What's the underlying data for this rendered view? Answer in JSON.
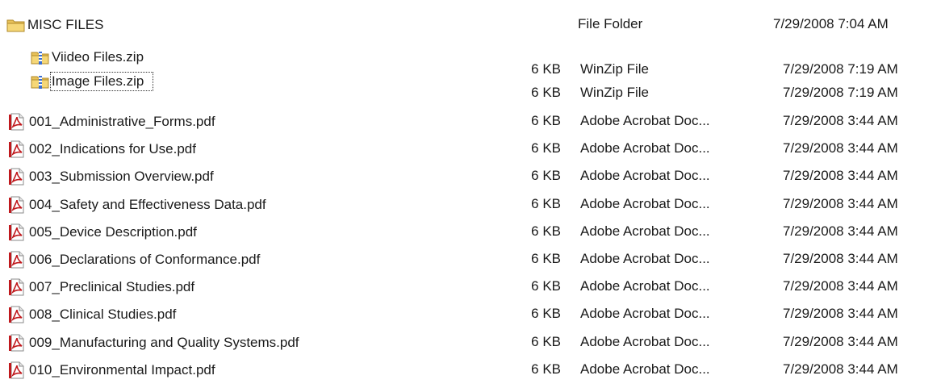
{
  "folder": {
    "name": "MISC FILES",
    "type": "File Folder",
    "modified": "7/29/2008 7:04 AM",
    "icon": "folder-icon"
  },
  "zip_files": [
    {
      "name": "Viideo Files.zip",
      "size": "6 KB",
      "type": "WinZip File",
      "modified": "7/29/2008 7:19 AM",
      "icon": "zip-folder-icon"
    },
    {
      "name": "Image Files.zip",
      "size": "6 KB",
      "type": "WinZip File",
      "modified": "7/29/2008 7:19 AM",
      "icon": "zip-folder-icon"
    }
  ],
  "pdf_files": [
    {
      "name": "001_Administrative_Forms.pdf",
      "size": "6 KB",
      "type": "Adobe Acrobat Doc...",
      "modified": "7/29/2008 3:44 AM",
      "icon": "pdf-icon"
    },
    {
      "name": "002_Indications for Use.pdf",
      "size": "6 KB",
      "type": "Adobe Acrobat Doc...",
      "modified": "7/29/2008 3:44 AM",
      "icon": "pdf-icon"
    },
    {
      "name": "003_Submission Overview.pdf",
      "size": "6 KB",
      "type": "Adobe Acrobat Doc...",
      "modified": "7/29/2008 3:44 AM",
      "icon": "pdf-icon"
    },
    {
      "name": "004_Safety and Effectiveness Data.pdf",
      "size": "6 KB",
      "type": "Adobe Acrobat Doc...",
      "modified": "7/29/2008 3:44 AM",
      "icon": "pdf-icon"
    },
    {
      "name": "005_Device Description.pdf",
      "size": "6 KB",
      "type": "Adobe Acrobat Doc...",
      "modified": "7/29/2008 3:44 AM",
      "icon": "pdf-icon"
    },
    {
      "name": "006_Declarations of Conformance.pdf",
      "size": "6 KB",
      "type": "Adobe Acrobat Doc...",
      "modified": "7/29/2008 3:44 AM",
      "icon": "pdf-icon"
    },
    {
      "name": "007_Preclinical Studies.pdf",
      "size": "6 KB",
      "type": "Adobe Acrobat Doc...",
      "modified": "7/29/2008 3:44 AM",
      "icon": "pdf-icon"
    },
    {
      "name": "008_Clinical Studies.pdf",
      "size": "6 KB",
      "type": "Adobe Acrobat Doc...",
      "modified": "7/29/2008 3:44 AM",
      "icon": "pdf-icon"
    },
    {
      "name": "009_Manufacturing and Quality Systems.pdf",
      "size": "6 KB",
      "type": "Adobe Acrobat Doc...",
      "modified": "7/29/2008 3:44 AM",
      "icon": "pdf-icon"
    },
    {
      "name": "010_Environmental Impact.pdf",
      "size": "6 KB",
      "type": "Adobe Acrobat Doc...",
      "modified": "7/29/2008 3:44 AM",
      "icon": "pdf-icon"
    }
  ]
}
